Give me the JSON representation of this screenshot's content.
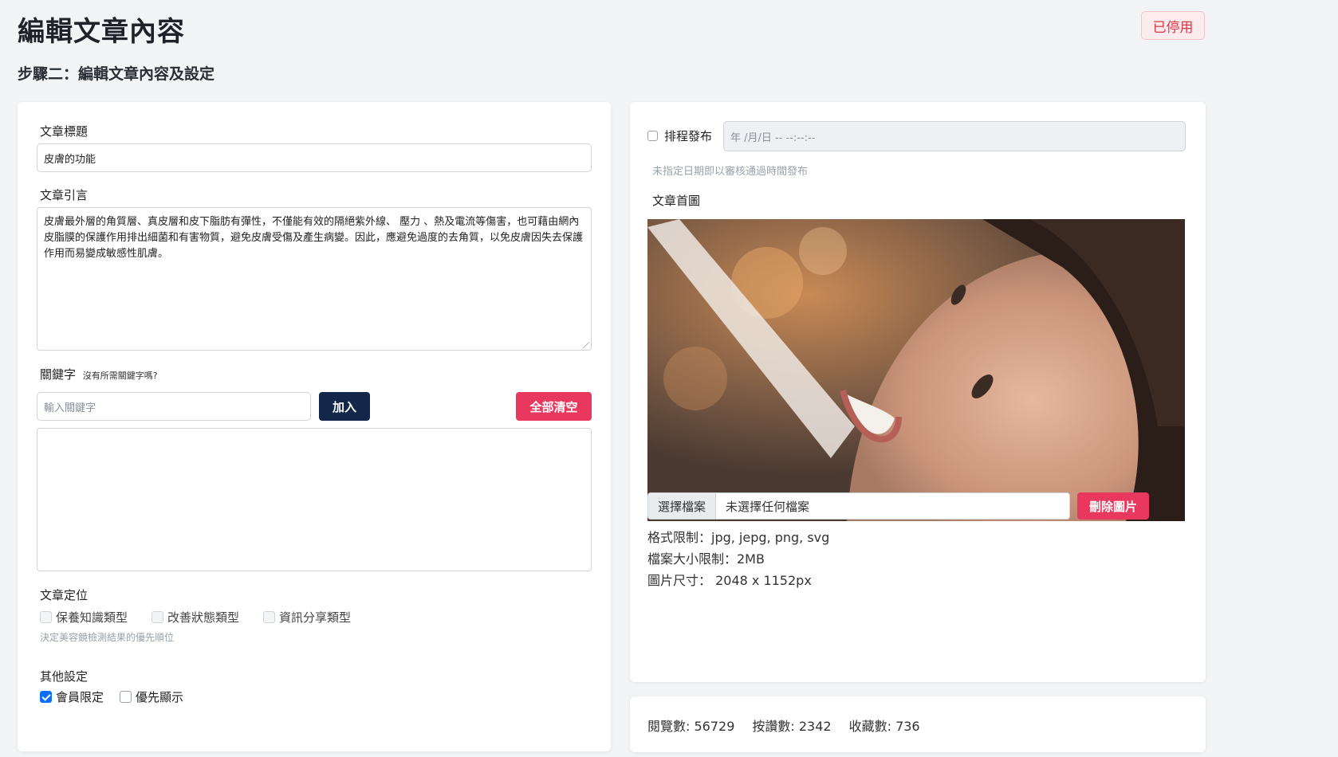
{
  "header": {
    "title": "編輯文章內容",
    "status_badge": "已停用",
    "step_title": "步驟二：編輯文章內容及設定"
  },
  "form": {
    "title_label": "文章標題",
    "title_value": "皮膚的功能",
    "intro_label": "文章引言",
    "intro_value": "皮膚最外層的角質層、真皮層和皮下脂肪有彈性，不僅能有效的隔絕紫外線、 壓力 、熱及電流等傷害，也可藉由網內皮脂膜的保護作用排出細菌和有害物質，避免皮膚受傷及產生病變。因此，應避免過度的去角質，以免皮膚因失去保護作用而易變成敏感性肌膚。",
    "keyword_label": "關鍵字",
    "keyword_hint": "沒有所需關鍵字嗎?",
    "keyword_placeholder": "輸入關鍵字",
    "add_button": "加入",
    "clear_button": "全部清空",
    "positioning_label": "文章定位",
    "positioning_options": [
      "保養知識類型",
      "改善狀態類型",
      "資訊分享類型"
    ],
    "positioning_help": "決定美容鏡檢測結果的優先順位",
    "other_label": "其他設定",
    "other_options": [
      {
        "label": "會員限定",
        "checked": true
      },
      {
        "label": "優先顯示",
        "checked": false
      }
    ]
  },
  "publish": {
    "schedule_label": "排程發布",
    "schedule_placeholder": "年 /月/日 -- --:--:--",
    "schedule_help": "未指定日期即以審核通過時間發布",
    "cover_label": "文章首圖",
    "choose_file_button": "選擇檔案",
    "no_file_text": "未選擇任何檔案",
    "delete_image_button": "刪除圖片",
    "format_limit": "格式限制：jpg, jepg, png, svg",
    "size_limit": "檔案大小限制：2MB",
    "image_size": "圖片尺寸： 2048 x 1152px"
  },
  "stats": {
    "views": "閱覽數: 56729",
    "likes": "按讚數: 2342",
    "favorites": "收藏數: 736"
  },
  "colors": {
    "navy": "#14264a",
    "danger": "#e8385d",
    "badge_text": "#dc3545",
    "primary": "#0d6efd"
  }
}
